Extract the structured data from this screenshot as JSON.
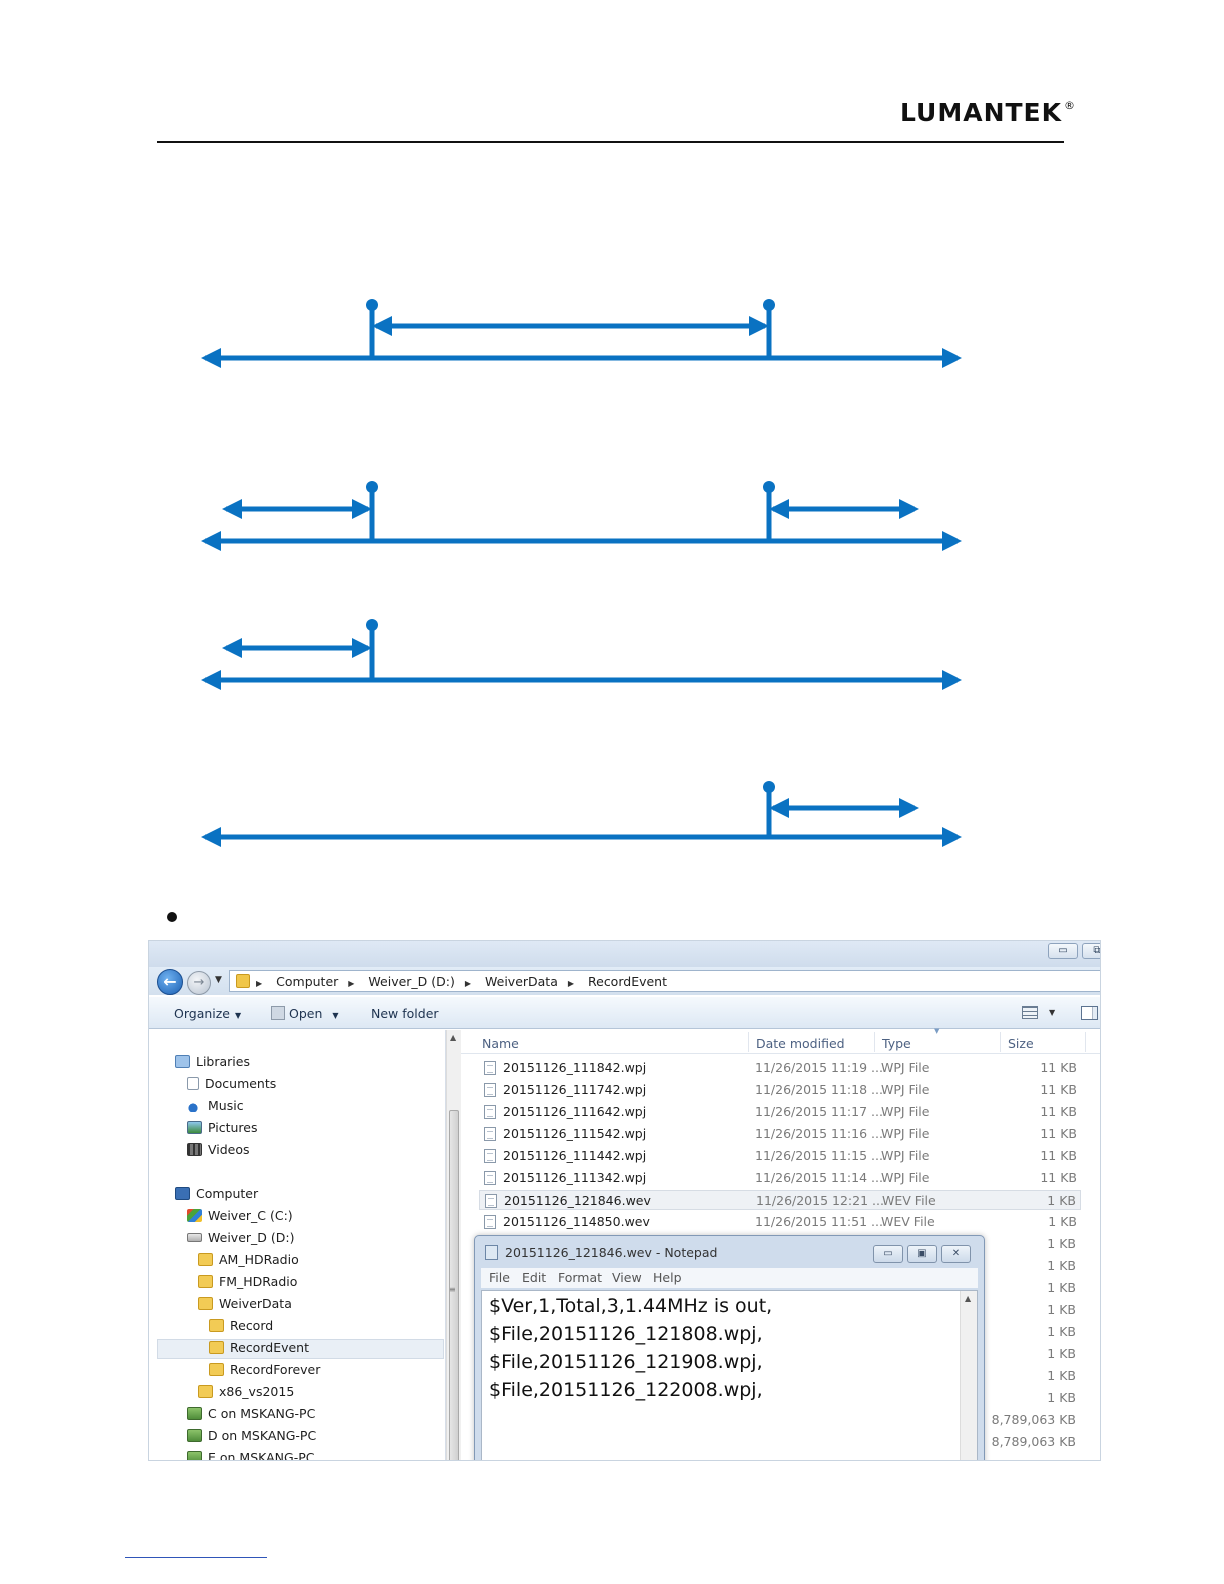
{
  "header": {
    "logo_text": "LUMANTEK",
    "logo_mark": "®"
  },
  "colors": {
    "arrow_blue": "#0a72c2"
  },
  "bullet": "•",
  "explorer": {
    "window_buttons": {
      "minimize": "▭",
      "restore": "⧉"
    },
    "breadcrumb": [
      "Computer",
      "Weiver_D (D:)",
      "WeiverData",
      "RecordEvent"
    ],
    "toolbar": {
      "organize": "Organize",
      "open": "Open",
      "new_folder": "New folder"
    },
    "nav_tree": [
      {
        "label": "Libraries",
        "icon": "library-icon"
      },
      {
        "label": "Documents",
        "icon": "documents-icon"
      },
      {
        "label": "Music",
        "icon": "music-icon"
      },
      {
        "label": "Pictures",
        "icon": "pictures-icon"
      },
      {
        "label": "Videos",
        "icon": "videos-icon"
      },
      {
        "label": "Computer",
        "icon": "computer-icon"
      },
      {
        "label": "Weiver_C (C:)",
        "icon": "windows-drive-icon"
      },
      {
        "label": "Weiver_D (D:)",
        "icon": "drive-icon"
      },
      {
        "label": "AM_HDRadio",
        "icon": "folder-icon"
      },
      {
        "label": "FM_HDRadio",
        "icon": "folder-icon"
      },
      {
        "label": "WeiverData",
        "icon": "folder-icon"
      },
      {
        "label": "Record",
        "icon": "folder-icon"
      },
      {
        "label": "RecordEvent",
        "icon": "folder-icon",
        "selected": true
      },
      {
        "label": "RecordForever",
        "icon": "folder-icon"
      },
      {
        "label": "x86_vs2015",
        "icon": "folder-icon"
      },
      {
        "label": "C on MSKANG-PC",
        "icon": "network-drive-icon"
      },
      {
        "label": "D on MSKANG-PC",
        "icon": "network-drive-icon"
      },
      {
        "label": "E on MSKANG-PC",
        "icon": "network-drive-icon"
      }
    ],
    "columns": {
      "name": "Name",
      "date": "Date modified",
      "type": "Type",
      "size": "Size"
    },
    "files": [
      {
        "name": "20151126_111842.wpj",
        "date": "11/26/2015 11:19 ...",
        "type": "WPJ File",
        "size": "11 KB"
      },
      {
        "name": "20151126_111742.wpj",
        "date": "11/26/2015 11:18 ...",
        "type": "WPJ File",
        "size": "11 KB"
      },
      {
        "name": "20151126_111642.wpj",
        "date": "11/26/2015 11:17 ...",
        "type": "WPJ File",
        "size": "11 KB"
      },
      {
        "name": "20151126_111542.wpj",
        "date": "11/26/2015 11:16 ...",
        "type": "WPJ File",
        "size": "11 KB"
      },
      {
        "name": "20151126_111442.wpj",
        "date": "11/26/2015 11:15 ...",
        "type": "WPJ File",
        "size": "11 KB"
      },
      {
        "name": "20151126_111342.wpj",
        "date": "11/26/2015 11:14 ...",
        "type": "WPJ File",
        "size": "11 KB"
      },
      {
        "name": "20151126_121846.wev",
        "date": "11/26/2015 12:21 ...",
        "type": "WEV File",
        "size": "1 KB",
        "selected": true
      },
      {
        "name": "20151126_114850.wev",
        "date": "11/26/2015 11:51 ...",
        "type": "WEV File",
        "size": "1 KB"
      }
    ],
    "hidden_sizes": [
      "1 KB",
      "1 KB",
      "1 KB",
      "1 KB",
      "1 KB",
      "1 KB",
      "1 KB",
      "1 KB",
      "8,789,063 KB",
      "8,789,063 KB"
    ],
    "notepad": {
      "title": "20151126_121846.wev - Notepad",
      "menu": [
        "File",
        "Edit",
        "Format",
        "View",
        "Help"
      ],
      "buttons": {
        "minimize": "▭",
        "maximize": "▣",
        "close": "✕"
      },
      "lines": [
        "$Ver,1,Total,3,1.44MHz is out,",
        "$File,20151126_121808.wpj,",
        "$File,20151126_121908.wpj,",
        "$File,20151126_122008.wpj,"
      ]
    }
  }
}
